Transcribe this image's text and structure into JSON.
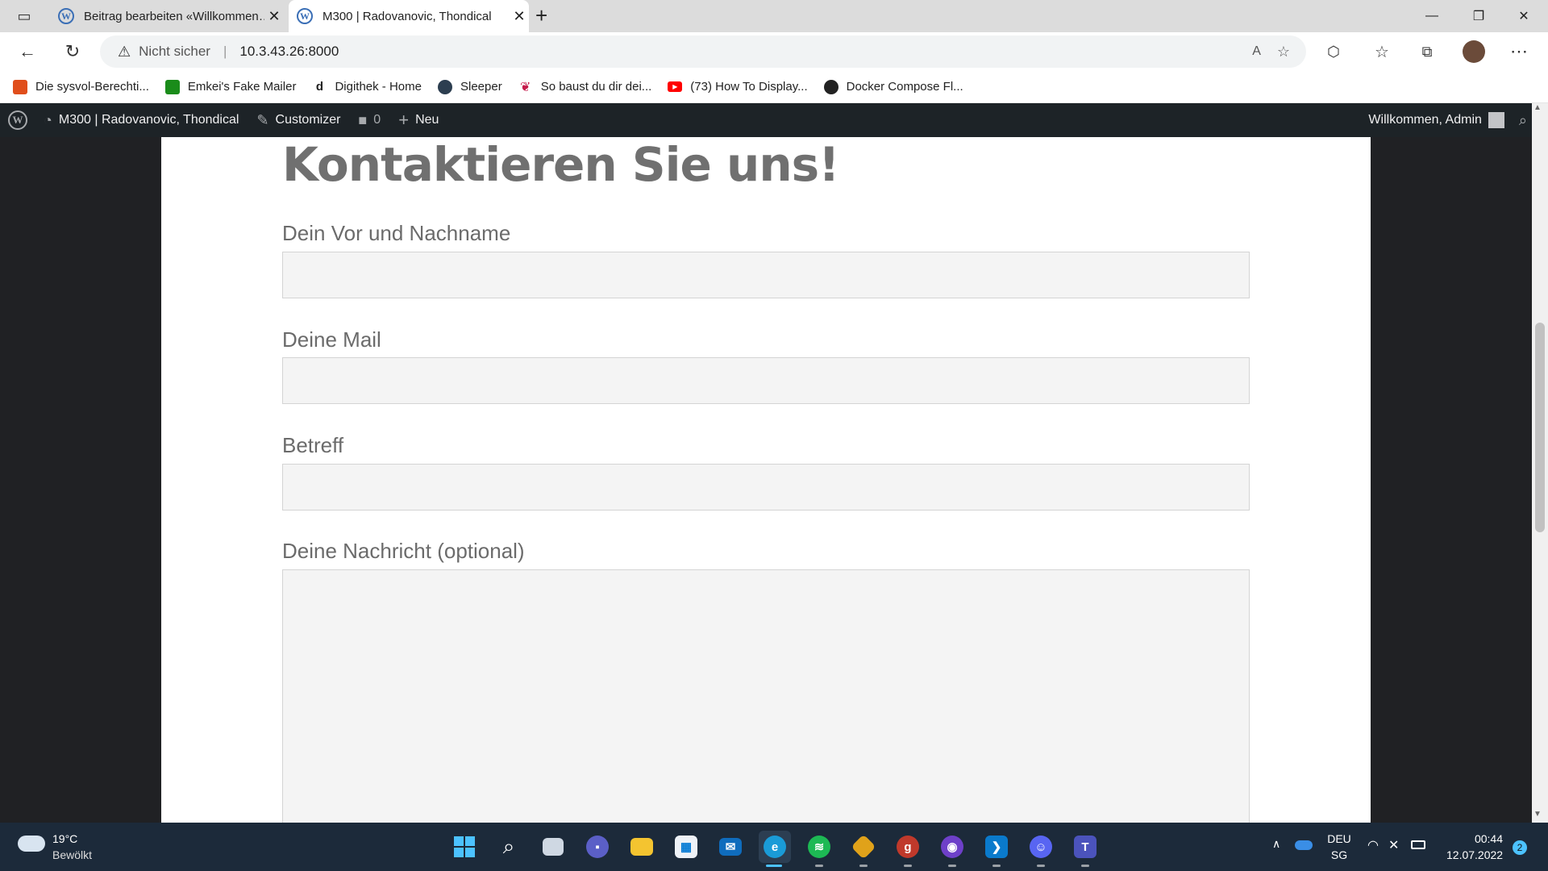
{
  "browser": {
    "tabs": [
      {
        "title": "Beitrag bearbeiten «Willkommen…",
        "active": false
      },
      {
        "title": "M300 | Radovanovic, Thondical",
        "active": true
      }
    ],
    "new_tab": "+",
    "security_label": "Nicht sicher",
    "url": "10.3.43.26:8000",
    "bookmarks": [
      "Die sysvol-Berechti...",
      "Emkei's Fake Mailer",
      "Digithek - Home",
      "Sleeper",
      "So baust du dir dei...",
      "(73) How To Display...",
      "Docker Compose Fl..."
    ]
  },
  "wp_admin_bar": {
    "site_name": "M300 | Radovanovic, Thondical",
    "customizer": "Customizer",
    "comments_count": "0",
    "new": "Neu",
    "greeting": "Willkommen, Admin"
  },
  "page": {
    "title": "Kontaktieren Sie uns!",
    "fields": [
      {
        "label": "Dein Vor und Nachname",
        "value": ""
      },
      {
        "label": "Deine Mail",
        "value": ""
      },
      {
        "label": "Betreff",
        "value": ""
      },
      {
        "label": "Deine Nachricht (optional)",
        "value": ""
      }
    ]
  },
  "taskbar": {
    "weather_temp": "19°C",
    "weather_desc": "Bewölkt",
    "language": "DEU",
    "region": "SG",
    "time": "00:44",
    "date": "12.07.2022",
    "notification_count": "2"
  },
  "colors": {
    "admin_bar": "#1d2327",
    "title_gray": "#707070",
    "field_bg": "#f4f4f4",
    "taskbar": "#1c2a3a"
  }
}
